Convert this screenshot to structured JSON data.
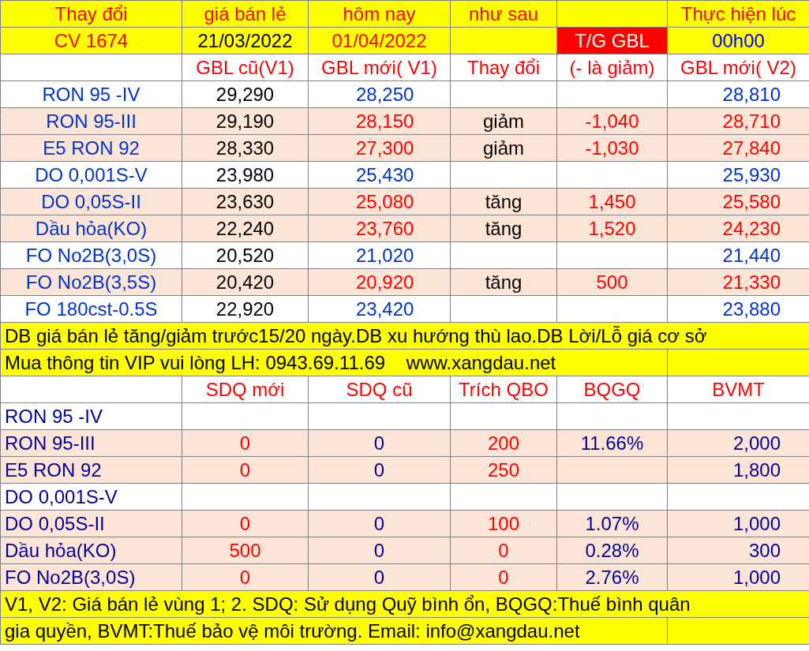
{
  "header_rows": [
    [
      {
        "text": "Thay đổi",
        "color": "#ff0000"
      },
      {
        "text": "giá bán lẻ",
        "color": "#ff0000"
      },
      {
        "text": "hôm nay",
        "color": "#ff0000"
      },
      {
        "text": "như sau",
        "color": "#ff0000"
      },
      {},
      {
        "text": "Thực hiện lúc",
        "color": "#ff0000"
      }
    ],
    [
      {
        "text": "CV 1674",
        "color": "#ff0000"
      },
      {
        "text": "21/03/2022",
        "color": "#000000"
      },
      {
        "text": "01/04/2022",
        "color": "#ff0000"
      },
      {},
      {
        "text": "T/G GBL",
        "color": "#ffffff",
        "kind": "badge"
      },
      {
        "text": "00h00",
        "color": "#0000ff"
      }
    ]
  ],
  "price_columns": [
    {},
    {
      "text": "GBL cũ(V1)"
    },
    {
      "text": "GBL mới( V1)"
    },
    {
      "text": "Thay đổi"
    },
    {
      "text": "(- là giảm)"
    },
    {
      "text": "GBL mới( V2)"
    }
  ],
  "price_rows": [
    {
      "highlighted": false,
      "cells": [
        {
          "text": "RON 95 -IV",
          "color": "#0033cc"
        },
        {
          "text": "29,290",
          "color": "#000000"
        },
        {
          "text": "28,250",
          "color": "#0033cc"
        },
        {},
        {},
        {
          "text": "28,810",
          "color": "#0033cc"
        }
      ]
    },
    {
      "highlighted": true,
      "cells": [
        {
          "text": "RON 95-III",
          "color": "#0033cc"
        },
        {
          "text": "29,190",
          "color": "#000000"
        },
        {
          "text": "28,150",
          "color": "#ff0000"
        },
        {
          "text": "giảm",
          "color": "#000000"
        },
        {
          "text": "-1,040",
          "color": "#ff0000"
        },
        {
          "text": "28,710",
          "color": "#ff0000"
        }
      ]
    },
    {
      "highlighted": true,
      "cells": [
        {
          "text": "E5 RON 92",
          "color": "#0033cc"
        },
        {
          "text": "28,330",
          "color": "#000000"
        },
        {
          "text": "27,300",
          "color": "#ff0000"
        },
        {
          "text": "giảm",
          "color": "#000000"
        },
        {
          "text": "-1,030",
          "color": "#ff0000"
        },
        {
          "text": "27,840",
          "color": "#ff0000"
        }
      ]
    },
    {
      "highlighted": false,
      "cells": [
        {
          "text": "DO 0,001S-V",
          "color": "#0033cc"
        },
        {
          "text": "23,980",
          "color": "#000000"
        },
        {
          "text": "25,430",
          "color": "#0033cc"
        },
        {},
        {},
        {
          "text": "25,930",
          "color": "#0033cc"
        }
      ]
    },
    {
      "highlighted": true,
      "cells": [
        {
          "text": "DO 0,05S-II",
          "color": "#0033cc"
        },
        {
          "text": "23,630",
          "color": "#000000"
        },
        {
          "text": "25,080",
          "color": "#ff0000"
        },
        {
          "text": "tăng",
          "color": "#000000"
        },
        {
          "text": "1,450",
          "color": "#ff0000"
        },
        {
          "text": "25,580",
          "color": "#ff0000"
        }
      ]
    },
    {
      "highlighted": true,
      "cells": [
        {
          "text": "Dầu hỏa(KO)",
          "color": "#0033cc"
        },
        {
          "text": "22,240",
          "color": "#000000"
        },
        {
          "text": "23,760",
          "color": "#ff0000"
        },
        {
          "text": "tăng",
          "color": "#000000"
        },
        {
          "text": "1,520",
          "color": "#ff0000"
        },
        {
          "text": "24,230",
          "color": "#ff0000"
        }
      ]
    },
    {
      "highlighted": false,
      "cells": [
        {
          "text": "FO No2B(3,0S)",
          "color": "#0033cc"
        },
        {
          "text": "20,520",
          "color": "#000000"
        },
        {
          "text": "21,020",
          "color": "#0033cc"
        },
        {},
        {},
        {
          "text": "21,440",
          "color": "#0033cc"
        }
      ]
    },
    {
      "highlighted": true,
      "cells": [
        {
          "text": "FO No2B(3,5S)",
          "color": "#0033cc"
        },
        {
          "text": "20,420",
          "color": "#000000"
        },
        {
          "text": "20,920",
          "color": "#ff0000"
        },
        {
          "text": "tăng",
          "color": "#000000"
        },
        {
          "text": "500",
          "color": "#ff0000"
        },
        {
          "text": "21,330",
          "color": "#ff0000"
        }
      ]
    },
    {
      "highlighted": false,
      "cells": [
        {
          "text": "FO 180cst-0.5S",
          "color": "#0033cc"
        },
        {
          "text": "22,920",
          "color": "#000000"
        },
        {
          "text": "23,420",
          "color": "#0033cc"
        },
        {},
        {},
        {
          "text": "23,880",
          "color": "#0033cc"
        }
      ]
    }
  ],
  "note": "DB giá bán lẻ tăng/giảm trước15/20 ngày.DB xu hướng thù lao.DB Lời/Lỗ giá cơ sở",
  "contact": "Mua thông tin VIP vui lòng LH: 0943.69.11.69    www.xangdau.net",
  "fund_columns": [
    {},
    {
      "text": "SDQ mới"
    },
    {
      "text": "SDQ cũ"
    },
    {
      "text": "Trích QBO"
    },
    {
      "text": "BQGQ"
    },
    {
      "text": "BVMT"
    }
  ],
  "fund_rows": [
    {
      "highlighted": false,
      "cells": [
        {
          "text": "RON 95 -IV"
        },
        {},
        {},
        {},
        {},
        {}
      ]
    },
    {
      "highlighted": true,
      "cells": [
        {
          "text": "RON 95-III"
        },
        {
          "text": "0"
        },
        {
          "text": "0"
        },
        {
          "text": "200"
        },
        {
          "text": "11.66%"
        },
        {
          "text": "2,000"
        }
      ]
    },
    {
      "highlighted": true,
      "cells": [
        {
          "text": "E5 RON 92"
        },
        {
          "text": "0"
        },
        {
          "text": "0"
        },
        {
          "text": "250"
        },
        {},
        {
          "text": "1,800"
        }
      ]
    },
    {
      "highlighted": false,
      "cells": [
        {
          "text": "DO 0,001S-V"
        },
        {},
        {},
        {},
        {},
        {}
      ]
    },
    {
      "highlighted": true,
      "cells": [
        {
          "text": "DO 0,05S-II"
        },
        {
          "text": "0"
        },
        {
          "text": "0"
        },
        {
          "text": "100"
        },
        {
          "text": "1.07%"
        },
        {
          "text": "1,000"
        }
      ]
    },
    {
      "highlighted": true,
      "cells": [
        {
          "text": "Dầu hỏa(KO)"
        },
        {
          "text": "500"
        },
        {
          "text": "0"
        },
        {
          "text": "0"
        },
        {
          "text": "0.28%"
        },
        {
          "text": "300"
        }
      ]
    },
    {
      "highlighted": true,
      "cells": [
        {
          "text": "FO No2B(3,0S)"
        },
        {
          "text": "0"
        },
        {
          "text": "0"
        },
        {
          "text": "0"
        },
        {
          "text": "2.76%"
        },
        {
          "text": "1,000"
        }
      ]
    }
  ],
  "footer_lines": [
    "V1, V2: Giá bán lẻ vùng 1; 2. SDQ: Sử dụng Quỹ bình ổn, BQGQ:Thuế bình quân",
    "gia quyền, BVMT:Thuế bảo vệ môi trường. Email: info@xangdau.net"
  ]
}
